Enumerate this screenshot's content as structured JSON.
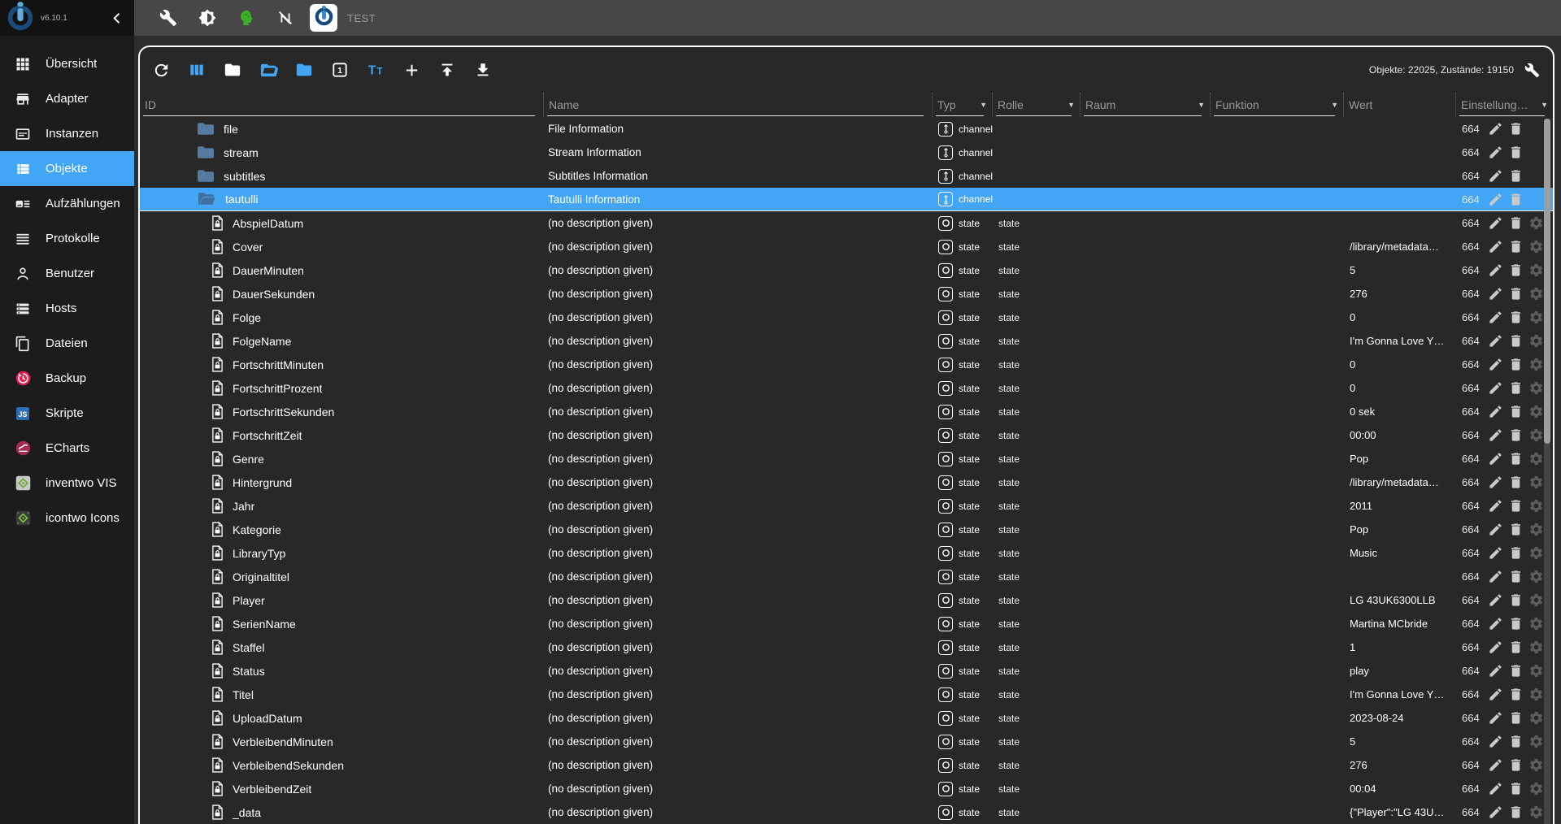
{
  "topbar": {
    "version": "v6.10.1",
    "tab_label": "TEST",
    "icons": [
      "wrench-icon",
      "theme-icon",
      "expert-mode-icon",
      "sync-off-icon"
    ]
  },
  "sidebar": {
    "items": [
      {
        "label": "Übersicht",
        "icon": "overview-grid-icon",
        "selected": false
      },
      {
        "label": "Adapter",
        "icon": "adapter-store-icon",
        "selected": false
      },
      {
        "label": "Instanzen",
        "icon": "instances-icon",
        "selected": false
      },
      {
        "label": "Objekte",
        "icon": "objects-list-icon",
        "selected": true
      },
      {
        "label": "Aufzählungen",
        "icon": "enums-icon",
        "selected": false
      },
      {
        "label": "Protokolle",
        "icon": "logs-icon",
        "selected": false
      },
      {
        "label": "Benutzer",
        "icon": "user-icon",
        "selected": false
      },
      {
        "label": "Hosts",
        "icon": "hosts-icon",
        "selected": false
      },
      {
        "label": "Dateien",
        "icon": "files-icon",
        "selected": false
      },
      {
        "label": "Backup",
        "icon": "backup-icon",
        "selected": false
      },
      {
        "label": "Skripte",
        "icon": "scripts-js-icon",
        "selected": false
      },
      {
        "label": "ECharts",
        "icon": "echarts-icon",
        "selected": false
      },
      {
        "label": "inventwo VIS",
        "icon": "inventwo-vis-icon",
        "selected": false
      },
      {
        "label": "icontwo Icons",
        "icon": "icontwo-icons-icon",
        "selected": false
      }
    ]
  },
  "panel": {
    "toolbar": {
      "icons": [
        "refresh-icon",
        "view-columns-icon",
        "collapse-folders-icon",
        "open-folders-icon",
        "expand-folders-icon",
        "depth-one-icon",
        "object-names-icon",
        "add-object-icon",
        "upload-icon",
        "download-icon"
      ],
      "stats": "Objekte: 22025, Zustände: 19150"
    },
    "header": {
      "columns": [
        {
          "label": "ID",
          "filter": false,
          "underline": true
        },
        {
          "label": "Name",
          "filter": false,
          "underline": true
        },
        {
          "label": "Typ",
          "filter": true,
          "underline": true
        },
        {
          "label": "Rolle",
          "filter": true,
          "underline": true
        },
        {
          "label": "Raum",
          "filter": true,
          "underline": true
        },
        {
          "label": "Funktion",
          "filter": true,
          "underline": true
        },
        {
          "label": "Wert",
          "filter": false,
          "underline": false
        },
        {
          "label": "Einstellung…",
          "filter": true,
          "underline": true
        }
      ]
    },
    "rows": [
      {
        "kind": "folder",
        "id": "file",
        "name": "File Information",
        "type": "channel",
        "role": "",
        "value": "",
        "acl": "664",
        "selected": false
      },
      {
        "kind": "folder",
        "id": "stream",
        "name": "Stream Information",
        "type": "channel",
        "role": "",
        "value": "",
        "acl": "664",
        "selected": false
      },
      {
        "kind": "folder",
        "id": "subtitles",
        "name": "Subtitles Information",
        "type": "channel",
        "role": "",
        "value": "",
        "acl": "664",
        "selected": false
      },
      {
        "kind": "folder",
        "id": "tautulli",
        "name": "Tautulli Information",
        "type": "channel",
        "role": "",
        "value": "",
        "acl": "664",
        "selected": true,
        "open": true
      },
      {
        "kind": "state",
        "id": "AbspielDatum",
        "name": "(no description given)",
        "type": "state",
        "role": "state",
        "value": "",
        "acl": "664",
        "selected": false
      },
      {
        "kind": "state",
        "id": "Cover",
        "name": "(no description given)",
        "type": "state",
        "role": "state",
        "value": "/library/metadata…",
        "acl": "664",
        "selected": false
      },
      {
        "kind": "state",
        "id": "DauerMinuten",
        "name": "(no description given)",
        "type": "state",
        "role": "state",
        "value": "5",
        "acl": "664",
        "selected": false
      },
      {
        "kind": "state",
        "id": "DauerSekunden",
        "name": "(no description given)",
        "type": "state",
        "role": "state",
        "value": "276",
        "acl": "664",
        "selected": false
      },
      {
        "kind": "state",
        "id": "Folge",
        "name": "(no description given)",
        "type": "state",
        "role": "state",
        "value": "0",
        "acl": "664",
        "selected": false
      },
      {
        "kind": "state",
        "id": "FolgeName",
        "name": "(no description given)",
        "type": "state",
        "role": "state",
        "value": "I'm Gonna Love Y…",
        "acl": "664",
        "selected": false
      },
      {
        "kind": "state",
        "id": "FortschrittMinuten",
        "name": "(no description given)",
        "type": "state",
        "role": "state",
        "value": "0",
        "acl": "664",
        "selected": false
      },
      {
        "kind": "state",
        "id": "FortschrittProzent",
        "name": "(no description given)",
        "type": "state",
        "role": "state",
        "value": "0",
        "acl": "664",
        "selected": false
      },
      {
        "kind": "state",
        "id": "FortschrittSekunden",
        "name": "(no description given)",
        "type": "state",
        "role": "state",
        "value": "0 sek",
        "acl": "664",
        "selected": false
      },
      {
        "kind": "state",
        "id": "FortschrittZeit",
        "name": "(no description given)",
        "type": "state",
        "role": "state",
        "value": "00:00",
        "acl": "664",
        "selected": false
      },
      {
        "kind": "state",
        "id": "Genre",
        "name": "(no description given)",
        "type": "state",
        "role": "state",
        "value": "Pop",
        "acl": "664",
        "selected": false
      },
      {
        "kind": "state",
        "id": "Hintergrund",
        "name": "(no description given)",
        "type": "state",
        "role": "state",
        "value": "/library/metadata…",
        "acl": "664",
        "selected": false
      },
      {
        "kind": "state",
        "id": "Jahr",
        "name": "(no description given)",
        "type": "state",
        "role": "state",
        "value": "2011",
        "acl": "664",
        "selected": false
      },
      {
        "kind": "state",
        "id": "Kategorie",
        "name": "(no description given)",
        "type": "state",
        "role": "state",
        "value": "Pop",
        "acl": "664",
        "selected": false
      },
      {
        "kind": "state",
        "id": "LibraryTyp",
        "name": "(no description given)",
        "type": "state",
        "role": "state",
        "value": "Music",
        "acl": "664",
        "selected": false
      },
      {
        "kind": "state",
        "id": "Originaltitel",
        "name": "(no description given)",
        "type": "state",
        "role": "state",
        "value": "",
        "acl": "664",
        "selected": false
      },
      {
        "kind": "state",
        "id": "Player",
        "name": "(no description given)",
        "type": "state",
        "role": "state",
        "value": "LG 43UK6300LLB",
        "acl": "664",
        "selected": false
      },
      {
        "kind": "state",
        "id": "SerienName",
        "name": "(no description given)",
        "type": "state",
        "role": "state",
        "value": "Martina MCbride",
        "acl": "664",
        "selected": false
      },
      {
        "kind": "state",
        "id": "Staffel",
        "name": "(no description given)",
        "type": "state",
        "role": "state",
        "value": "1",
        "acl": "664",
        "selected": false
      },
      {
        "kind": "state",
        "id": "Status",
        "name": "(no description given)",
        "type": "state",
        "role": "state",
        "value": "play",
        "acl": "664",
        "selected": false
      },
      {
        "kind": "state",
        "id": "Titel",
        "name": "(no description given)",
        "type": "state",
        "role": "state",
        "value": "I'm Gonna Love Y…",
        "acl": "664",
        "selected": false
      },
      {
        "kind": "state",
        "id": "UploadDatum",
        "name": "(no description given)",
        "type": "state",
        "role": "state",
        "value": "2023-08-24",
        "acl": "664",
        "selected": false
      },
      {
        "kind": "state",
        "id": "VerbleibendMinuten",
        "name": "(no description given)",
        "type": "state",
        "role": "state",
        "value": "5",
        "acl": "664",
        "selected": false
      },
      {
        "kind": "state",
        "id": "VerbleibendSekunden",
        "name": "(no description given)",
        "type": "state",
        "role": "state",
        "value": "276",
        "acl": "664",
        "selected": false
      },
      {
        "kind": "state",
        "id": "VerbleibendZeit",
        "name": "(no description given)",
        "type": "state",
        "role": "state",
        "value": "00:04",
        "acl": "664",
        "selected": false
      },
      {
        "kind": "state",
        "id": "_data",
        "name": "(no description given)",
        "type": "state",
        "role": "state",
        "value": "{\"Player\":\"LG 43U…",
        "acl": "664",
        "selected": false
      }
    ]
  }
}
